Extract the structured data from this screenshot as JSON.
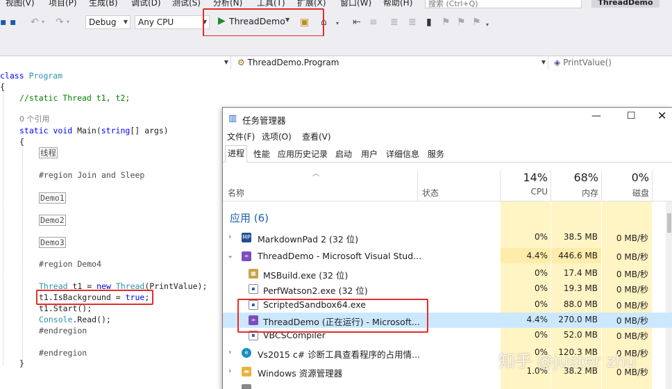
{
  "menubar": {
    "items": [
      "视图(V)",
      "项目(P)",
      "生成(B)",
      "调试(D)",
      "分析(N)",
      "工具(T)",
      "扩展(X)",
      "窗口(W)",
      "帮助(H)"
    ],
    "search_placeholder": "搜索 (Ctrl+Q)",
    "solution_name": "ThreadDemo"
  },
  "toolbar": {
    "config": "Debug",
    "platform": "Any CPU",
    "start_label": "ThreadDemo"
  },
  "navbar": {
    "class_combo": "ThreadDemo.Program",
    "member_combo": "PrintValue()"
  },
  "code": {
    "l1_kw": "class",
    "l1_ty": "Program",
    "brace_open": "{",
    "comment": "//static Thread t1, t2;",
    "codelens": "0 个引用",
    "main_kw1": "static",
    "main_kw2": "void",
    "main_name": "Main(",
    "main_kw3": "string",
    "main_rest": "[] args)",
    "inner_open": "{",
    "region_threads": "线程",
    "region_join": "#region Join and Sleep",
    "demo1": "Demo1",
    "demo2": "Demo2",
    "demo3": "Demo3",
    "region_demo4": "#region Demo4",
    "decl_ty1": "Thread",
    "decl_mid": " t1 = ",
    "decl_kw": "new",
    "decl_ty2": "Thread",
    "decl_end": "(PrintValue);",
    "isbg_pre": "t1.IsBackground = ",
    "isbg_kw": "true",
    "isbg_end": ";",
    "start": "t1.Start();",
    "console_ty": "Console",
    "console_rest": ".Read();",
    "endregion1": "#endregion",
    "endregion2": "#endregion",
    "inner_close": "}"
  },
  "taskmanager": {
    "title": "任务管理器",
    "menu": [
      "文件(F)",
      "选项(O)",
      "查看(V)"
    ],
    "tabs": [
      "进程",
      "性能",
      "应用历史记录",
      "启动",
      "用户",
      "详细信息",
      "服务"
    ],
    "columns": {
      "name": "名称",
      "status": "状态",
      "cpu_pct": "14%",
      "cpu": "CPU",
      "mem_pct": "68%",
      "mem": "内存",
      "disk_pct": "0%",
      "disk": "磁盘"
    },
    "group_apps": "应用 (6)",
    "rows": [
      {
        "name": "MarkdownPad 2 (32 位)",
        "cpu": "0%",
        "mem": "38.5 MB",
        "disk": "0 MB/秒",
        "icon": "MP"
      },
      {
        "name": "ThreadDemo - Microsoft Visual Stud...",
        "cpu": "4.4%",
        "mem": "446.6 MB",
        "disk": "0 MB/秒",
        "icon": "vs"
      },
      {
        "name": "MSBuild.exe (32 位)",
        "cpu": "0%",
        "mem": "17.4 MB",
        "disk": "0 MB/秒",
        "icon": "app"
      },
      {
        "name": "PerfWatson2.exe (32 位)",
        "cpu": "0%",
        "mem": "19.3 MB",
        "disk": "0 MB/秒",
        "icon": "win"
      },
      {
        "name": "ScriptedSandbox64.exe",
        "cpu": "0%",
        "mem": "88.0 MB",
        "disk": "0 MB/秒",
        "icon": "win"
      },
      {
        "name": "ThreadDemo (正在运行) - Microsoft...",
        "cpu": "4.4%",
        "mem": "270.0 MB",
        "disk": "0 MB/秒",
        "icon": "vs"
      },
      {
        "name": "VBCSCompiler",
        "cpu": "0%",
        "mem": "52.0 MB",
        "disk": "0 MB/秒",
        "icon": "win"
      },
      {
        "name": "Vs2015 c# 诊断工具查看程序的占用情...",
        "cpu": "0%",
        "mem": "120.3 MB",
        "disk": "0 MB/秒",
        "icon": "edge"
      },
      {
        "name": "Windows 资源管理器",
        "cpu": "1.0%",
        "mem": "38.2 MB",
        "disk": "0 MB/秒",
        "icon": "folder"
      }
    ]
  },
  "watermark": "知乎 @juster zhu"
}
